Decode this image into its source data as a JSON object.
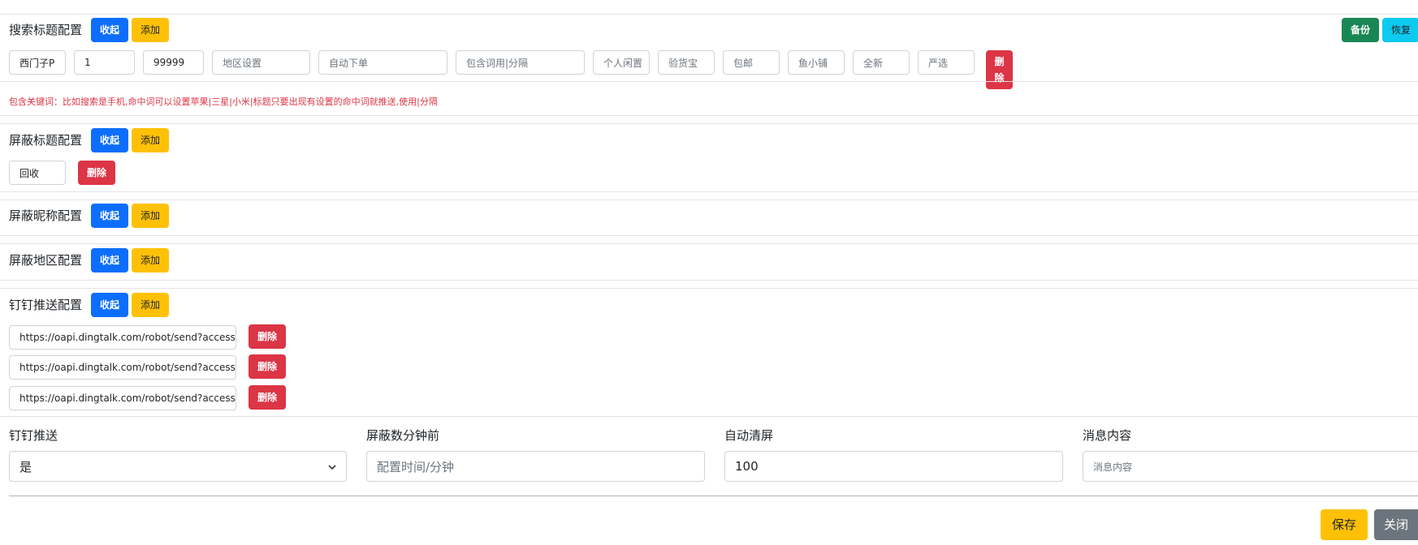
{
  "search": {
    "title": "搜索标题配置",
    "collapse": "收起",
    "add": "添加",
    "backup": "备份",
    "restore": "恢复",
    "fields": [
      "西门子P",
      "1",
      "99999",
      "地区设置",
      "自动下单",
      "包含词用|分隔",
      "个人闲置",
      "验货宝",
      "包邮",
      "鱼小铺",
      "全新",
      "严选"
    ],
    "delete_line1": "删",
    "delete_line2": "除",
    "hint": "包含关键词：比如搜索是手机,命中词可以设置苹果|三星|小米|标题只要出现有设置的命中词就推送,使用|分隔"
  },
  "block_title": {
    "title": "屏蔽标题配置",
    "collapse": "收起",
    "add": "添加",
    "value": "回收",
    "delete": "删除"
  },
  "block_nick": {
    "title": "屏蔽昵称配置",
    "collapse": "收起",
    "add": "添加"
  },
  "block_region": {
    "title": "屏蔽地区配置",
    "collapse": "收起",
    "add": "添加"
  },
  "dingtalk": {
    "title": "钉钉推送配置",
    "collapse": "收起",
    "add": "添加",
    "urls": [
      "https://oapi.dingtalk.com/robot/send?access",
      "https://oapi.dingtalk.com/robot/send?access",
      "https://oapi.dingtalk.com/robot/send?access"
    ],
    "delete": "删除"
  },
  "settings": {
    "push_label": "钉钉推送",
    "push_value": "是",
    "minutes_label": "屏蔽数分钟前",
    "minutes_placeholder": "配置时间/分钟",
    "clear_label": "自动清屏",
    "clear_value": "100",
    "message_label": "消息内容",
    "message_placeholder": "消息内容"
  },
  "footer": {
    "save": "保存",
    "close": "关闭"
  },
  "colors": {
    "primary": "#0d6efd",
    "warning": "#ffc107",
    "danger": "#dc3545",
    "success": "#198754",
    "info": "#0dcaf0",
    "secondary": "#6c757d"
  },
  "icons": [
    "chevron-down-icon"
  ]
}
